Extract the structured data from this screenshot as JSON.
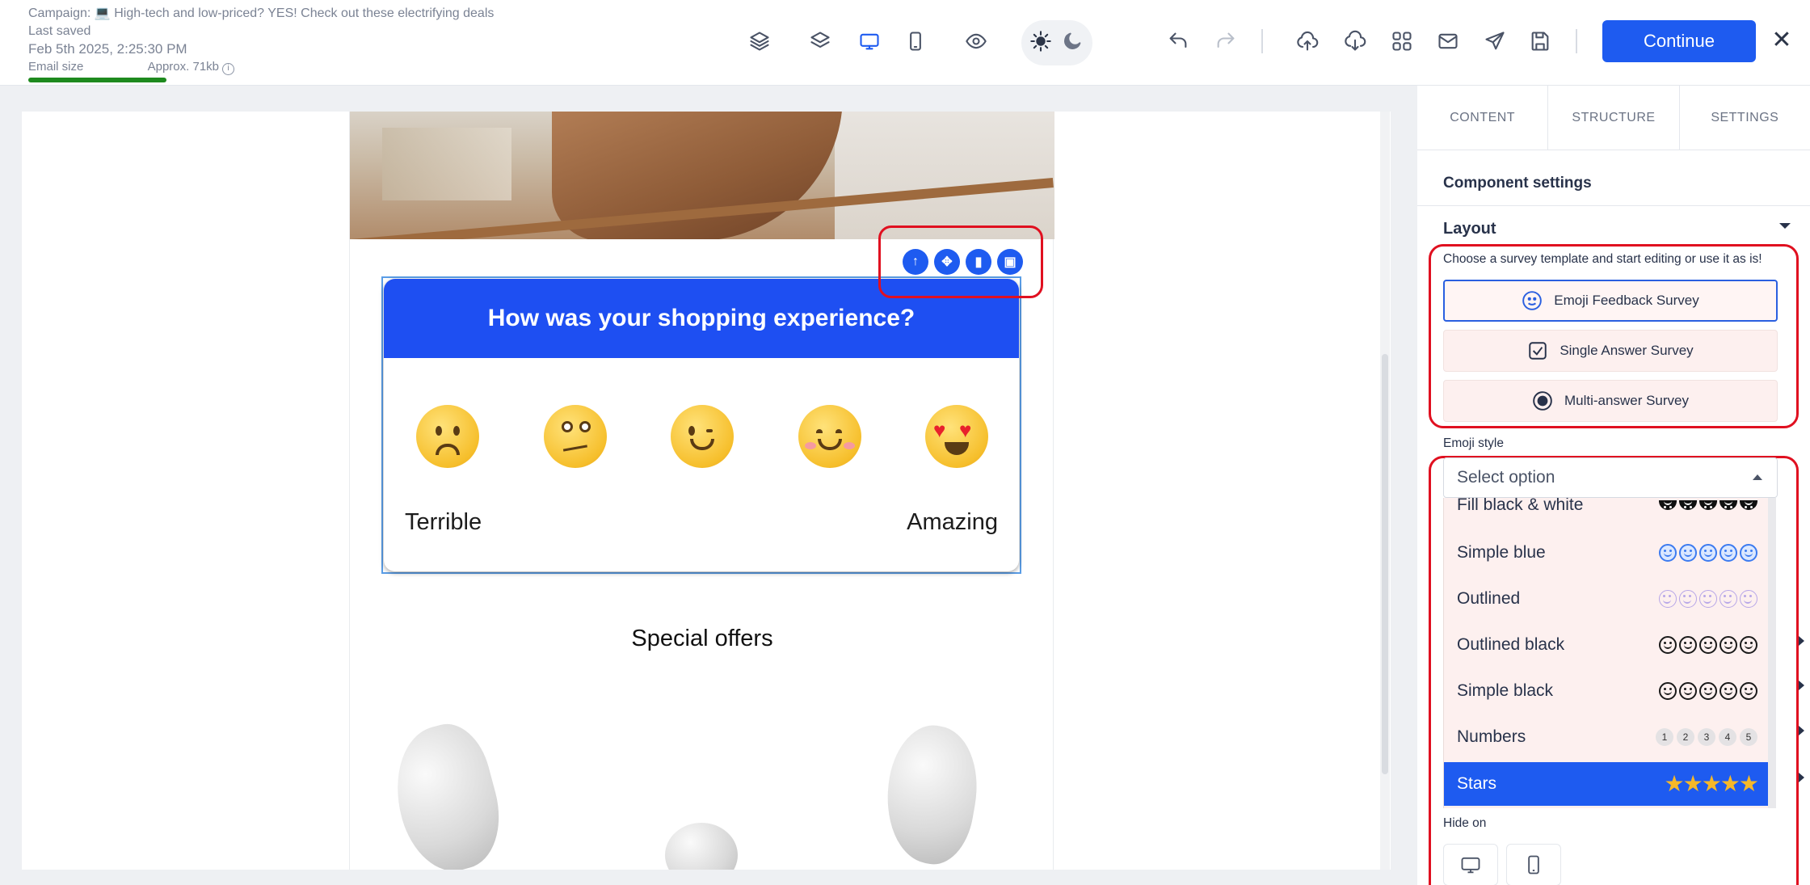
{
  "header": {
    "campaign_label": "Campaign: ",
    "campaign_emoji": "💻",
    "campaign_name": "High-tech and low-priced? YES! Check out these electrifying deals",
    "last_saved_label": "Last saved",
    "last_saved": "Feb 5th 2025, 2:25:30 PM",
    "email_size_label": "Email size",
    "email_size_value": "Approx. 71kb",
    "email_size_fill": 0.57,
    "continue_label": "Continue",
    "close_glyph": "✕"
  },
  "toolbar_icons": [
    "layers-outline-icon",
    "layers-icon",
    "desktop-icon",
    "mobile-icon",
    "preview-eye-icon",
    "sun-icon",
    "moon-icon",
    "undo-icon",
    "redo-icon",
    "upload-icon",
    "download-icon",
    "modules-grid-icon",
    "mail-icon",
    "send-icon",
    "save-icon"
  ],
  "accent_color": "#1e5bf0",
  "highlight_color": "#e01020",
  "email": {
    "survey_title": "How was your shopping experience?",
    "scale_low": "Terrible",
    "scale_high": "Amazing",
    "emojis": [
      "worried-face",
      "rolling-eyes-face",
      "winking-face",
      "smiling-face",
      "heart-eyes-face"
    ],
    "offers_title": "Special offers",
    "block_tools": [
      "move-up-icon",
      "drag-icon",
      "delete-icon",
      "save-block-icon"
    ]
  },
  "panel": {
    "tabs": [
      "CONTENT",
      "STRUCTURE",
      "SETTINGS"
    ],
    "component_settings": "Component settings",
    "layout_title": "Layout",
    "template_hint": "Choose a survey template and start editing or use it as is!",
    "templates": [
      {
        "label": "Emoji Feedback Survey",
        "icon": "smiley-icon",
        "selected": true
      },
      {
        "label": "Single Answer Survey",
        "icon": "checkbox-icon",
        "selected": false
      },
      {
        "label": "Multi-answer Survey",
        "icon": "radio-icon",
        "selected": false
      }
    ],
    "emoji_style_label": "Emoji style",
    "select_placeholder": "Select option",
    "options": [
      {
        "label": "Fill black & white",
        "preview": "fill"
      },
      {
        "label": "Simple blue",
        "preview": "blue"
      },
      {
        "label": "Outlined",
        "preview": "outlined"
      },
      {
        "label": "Outlined black",
        "preview": "black"
      },
      {
        "label": "Simple black",
        "preview": "black"
      },
      {
        "label": "Numbers",
        "preview": "numbers",
        "numbers": [
          "1",
          "2",
          "3",
          "4",
          "5"
        ]
      },
      {
        "label": "Stars",
        "preview": "stars",
        "stars": "★★★★★",
        "highlighted": true
      }
    ],
    "hide_on_label": "Hide on"
  }
}
